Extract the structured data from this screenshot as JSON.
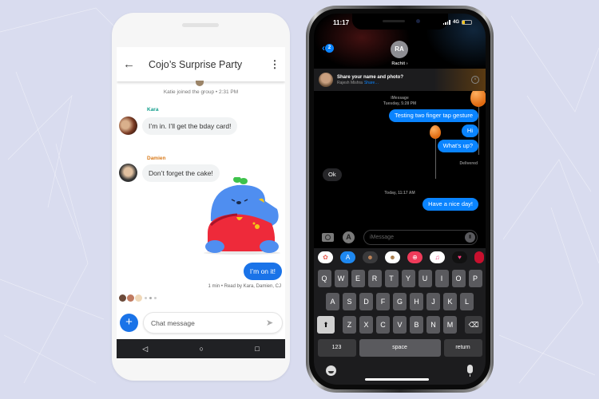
{
  "android": {
    "header": {
      "title": "Cojo’s Surprise Party",
      "back_icon": "←",
      "more_icon": "⋮"
    },
    "system_message": "Katie joined the group • 2:31 PM",
    "messages": [
      {
        "sender": "Kara",
        "sender_color": "#129e8c",
        "text": "I’m in. I’ll get the bday card!"
      },
      {
        "sender": "Damien",
        "sender_color": "#d97a1a",
        "text": "Don’t forget the cake!"
      }
    ],
    "outgoing": {
      "text": "I’m on it!"
    },
    "read_receipt": "1 min • Read by Kara, Damien, CJ",
    "composer": {
      "placeholder": "Chat message",
      "add_icon": "+",
      "send_icon": "➤"
    },
    "navbar": {
      "back": "◁",
      "home": "○",
      "recents": "□"
    },
    "accent_color": "#1a73e8"
  },
  "iphone": {
    "status": {
      "time": "11:17",
      "network": "4G"
    },
    "back_badge": "2",
    "contact": {
      "initials": "RA",
      "name": "Rachit ›"
    },
    "banner": {
      "title": "Share your name and photo?",
      "name": "Rajesh Mishra",
      "link": "Share…",
      "close_icon": "×"
    },
    "meta_1_line1": "iMessage",
    "meta_1_line2": "Tuesday, 5:28 PM",
    "outgoing_1": [
      "Testing two finger tap gesture",
      "Hi",
      "What’s up?"
    ],
    "delivered": "Delivered",
    "incoming": "Ok",
    "meta_2": "Today, 11:17 AM",
    "outgoing_2": "Have a nice day!",
    "composer_placeholder": "iMessage",
    "keyboard": {
      "row1": [
        "Q",
        "W",
        "E",
        "R",
        "T",
        "Y",
        "U",
        "I",
        "O",
        "P"
      ],
      "row2": [
        "A",
        "S",
        "D",
        "F",
        "G",
        "H",
        "J",
        "K",
        "L"
      ],
      "row3": [
        "Z",
        "X",
        "C",
        "V",
        "B",
        "N",
        "M"
      ],
      "shift": "⬆",
      "backspace": "⌫",
      "numbers": "123",
      "space": "space",
      "return": "return"
    },
    "accent_color": "#0a84ff"
  }
}
